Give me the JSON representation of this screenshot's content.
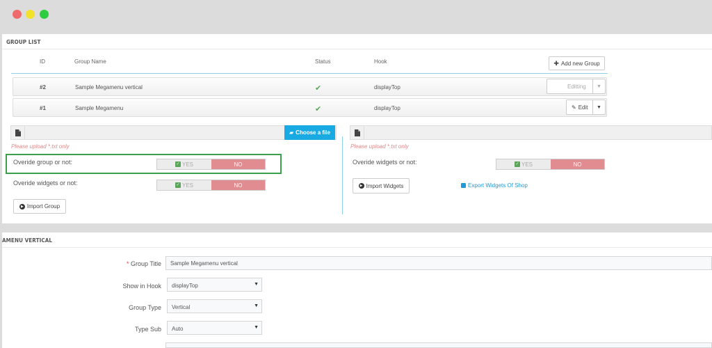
{
  "window": {
    "controls": [
      "close",
      "minimize",
      "maximize"
    ]
  },
  "group_list": {
    "title": "GROUP LIST",
    "columns": {
      "id": "ID",
      "name": "Group Name",
      "status": "Status",
      "hook": "Hook"
    },
    "add_button": "Add new Group",
    "rows": [
      {
        "id": "#2",
        "name": "Sample Megamenu vertical",
        "status": "enabled",
        "hook": "displayTop",
        "action": "Editting"
      },
      {
        "id": "#1",
        "name": "Sample Megamenu",
        "status": "enabled",
        "hook": "displayTop",
        "action": "Edit"
      }
    ]
  },
  "import_group": {
    "choose_file": "Choose a file",
    "hint": "Please upload *.txt only",
    "override_group_label": "Overide group or not:",
    "override_widgets_label": "Overide widgets or not:",
    "yes": "YES",
    "no": "NO",
    "import_button": "Import Group"
  },
  "import_widgets": {
    "hint": "Please upload *.txt only",
    "override_widgets_label": "Overide widgets or not:",
    "yes": "YES",
    "no": "NO",
    "import_button": "Import Widgets",
    "export_link": "Export Widgets Of Shop"
  },
  "megamenu_form": {
    "title": "AMENU VERTICAL",
    "group_title_label": "Group Title",
    "group_title_value": "Sample Megamenu vertical",
    "show_in_hook_label": "Show in Hook",
    "show_in_hook_value": "displayTop",
    "group_type_label": "Group Type",
    "group_type_value": "Vertical",
    "type_sub_label": "Type Sub",
    "type_sub_value": "Auto"
  },
  "colors": {
    "accent": "#19a9e3",
    "no_toggle": "#e08c90",
    "highlight": "#3aa14a",
    "required": "#e8413e",
    "check": "#5aa55a"
  }
}
